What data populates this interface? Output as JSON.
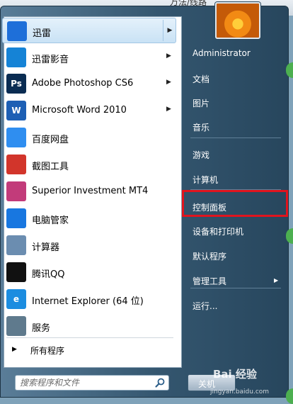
{
  "background": {
    "top_text": "万法/线路"
  },
  "programs": [
    {
      "name": "xunlei",
      "label": "迅雷",
      "icon": "xunlei-bird-icon",
      "color": "#1e6fd9",
      "has_arrow": true,
      "highlighted": true
    },
    {
      "name": "xunlei-player",
      "label": "迅雷影音",
      "icon": "xunlei-player-icon",
      "color": "#1583d6",
      "has_arrow": true
    },
    {
      "name": "photoshop",
      "label": "Adobe Photoshop CS6",
      "icon": "photoshop-icon",
      "icon_text": "Ps",
      "color": "#0a2c52",
      "has_arrow": true
    },
    {
      "name": "word",
      "label": "Microsoft Word 2010",
      "icon": "word-icon",
      "icon_text": "W",
      "color": "#1d5fb4",
      "has_arrow": true
    },
    {
      "name": "baidu-pan",
      "label": "百度网盘",
      "icon": "baidu-pan-icon",
      "color": "#2f8ef0",
      "has_arrow": false
    },
    {
      "name": "snipping",
      "label": "截图工具",
      "icon": "scissors-icon",
      "color": "#d2352b",
      "has_arrow": false
    },
    {
      "name": "mt4",
      "label": "Superior Investment MT4",
      "icon": "mt4-icon",
      "color": "#c23b7a",
      "has_arrow": false
    },
    {
      "name": "pc-manager",
      "label": "电脑管家",
      "icon": "shield-icon",
      "color": "#1877e0",
      "has_arrow": false
    },
    {
      "name": "calculator",
      "label": "计算器",
      "icon": "calculator-icon",
      "color": "#6b8db0",
      "has_arrow": false
    },
    {
      "name": "qq",
      "label": "腾讯QQ",
      "icon": "qq-penguin-icon",
      "color": "#111111",
      "has_arrow": false
    },
    {
      "name": "ie",
      "label": "Internet Explorer (64 位)",
      "icon": "internet-explorer-icon",
      "icon_text": "e",
      "color": "#1c8de0",
      "has_arrow": false
    },
    {
      "name": "services",
      "label": "服务",
      "icon": "gears-icon",
      "color": "#5f7a8d",
      "has_arrow": false
    }
  ],
  "all_programs": {
    "label": "所有程序"
  },
  "search": {
    "placeholder": "搜索程序和文件"
  },
  "right": [
    {
      "name": "administrator",
      "label": "Administrator"
    },
    {
      "name": "documents",
      "label": "文档"
    },
    {
      "name": "pictures",
      "label": "图片"
    },
    {
      "name": "music",
      "label": "音乐",
      "sep_after": true
    },
    {
      "name": "games",
      "label": "游戏"
    },
    {
      "name": "computer",
      "label": "计算机",
      "sep_after": true
    },
    {
      "name": "control-panel",
      "label": "控制面板",
      "boxed": true
    },
    {
      "name": "devices-printers",
      "label": "设备和打印机"
    },
    {
      "name": "default-programs",
      "label": "默认程序"
    },
    {
      "name": "admin-tools",
      "label": "管理工具",
      "has_arrow": true,
      "sep_after": true
    },
    {
      "name": "run",
      "label": "运行..."
    }
  ],
  "shutdown": {
    "label": "关机"
  },
  "watermark": {
    "text": "Bai 经验",
    "sub": "jingyan.baidu.com"
  },
  "colors": {
    "highlight_box": "#e0141e",
    "accent": "#1e6fd9"
  }
}
